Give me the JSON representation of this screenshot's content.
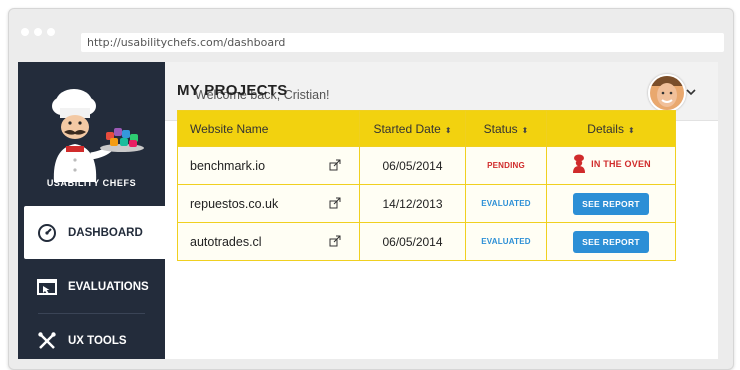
{
  "browser": {
    "url": "http://usabilitychefs.com/dashboard"
  },
  "sidebar": {
    "brand": "USABILITY CHEFS",
    "items": [
      {
        "label": "DASHBOARD",
        "icon": "gauge-icon",
        "active": true
      },
      {
        "label": "EVALUATIONS",
        "icon": "cursor-window-icon",
        "active": false
      },
      {
        "label": "UX TOOLS",
        "icon": "crossed-tools-icon",
        "active": false
      }
    ]
  },
  "header": {
    "welcome": "Welcome back, Cristian!"
  },
  "main": {
    "title": "MY PROJECTS",
    "columns": [
      "Website Name",
      "Started Date",
      "Status",
      "Details"
    ],
    "rows": [
      {
        "site": "benchmark.io",
        "date": "06/05/2014",
        "status": "PENDING",
        "details": "IN THE OVEN"
      },
      {
        "site": "repuestos.co.uk",
        "date": "14/12/2013",
        "status": "EVALUATED",
        "details": "SEE REPORT"
      },
      {
        "site": "autotrades.cl",
        "date": "06/05/2014",
        "status": "EVALUATED",
        "details": "SEE REPORT"
      }
    ]
  },
  "colors": {
    "sidebar_bg": "#232c3b",
    "table_header": "#f2d20f",
    "pending": "#d02b2b",
    "evaluated": "#2c8fd6",
    "button": "#2c8fd6"
  }
}
